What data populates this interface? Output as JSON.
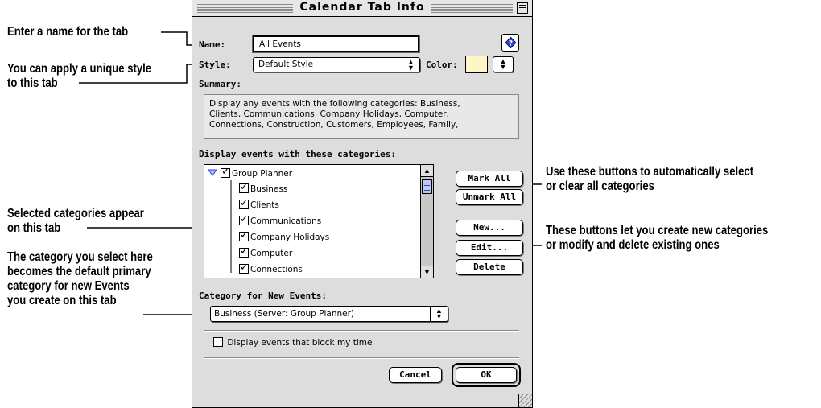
{
  "window": {
    "title": "Calendar Tab Info",
    "name_label": "Name:",
    "name_value": "All Events",
    "style_label": "Style:",
    "style_value": "Default Style",
    "color_label": "Color:",
    "color_swatch": "#fff6c8",
    "summary_label": "Summary:",
    "summary_lines": [
      "Display any events with the following categories: Business,",
      "Clients, Communications, Company Holidays, Computer,",
      "Connections, Construction, Customers, Employees, Family,"
    ],
    "categories_label": "Display events with these categories:",
    "categories": [
      {
        "label": "Group Planner",
        "checked": true,
        "level": 0
      },
      {
        "label": "Business",
        "checked": true,
        "level": 1
      },
      {
        "label": "Clients",
        "checked": true,
        "level": 1
      },
      {
        "label": "Communications",
        "checked": true,
        "level": 1
      },
      {
        "label": "Company Holidays",
        "checked": true,
        "level": 1
      },
      {
        "label": "Computer",
        "checked": true,
        "level": 1
      },
      {
        "label": "Connections",
        "checked": true,
        "level": 1
      }
    ],
    "buttons": {
      "mark_all": "Mark All",
      "unmark_all": "Unmark All",
      "new": "New...",
      "edit": "Edit...",
      "delete": "Delete",
      "cancel": "Cancel",
      "ok": "OK"
    },
    "new_events_label": "Category for New Events:",
    "new_events_value": "Business (Server: Group Planner)",
    "block_time_label": "Display events that block my time",
    "block_time_checked": false
  },
  "callouts": {
    "name": "Enter a name for the tab",
    "style_line1": "You can apply a unique style",
    "style_line2": "to this tab",
    "selected_line1": "Selected categories appear",
    "selected_line2": "on this tab",
    "primary_line1": "The category you select here",
    "primary_line2": "becomes the default primary",
    "primary_line3": "category for new Events",
    "primary_line4": "you create on this tab",
    "markall_line1": "Use these buttons to automatically select",
    "markall_line2": "or clear all categories",
    "newedit_line1": "These buttons let you create new categories",
    "newedit_line2": "or modify and delete existing ones"
  },
  "icons": {
    "help": "help-balloon-icon",
    "disclosure": "disclosure-triangle-open-icon",
    "popup_arrows": "up-down-arrows-icon",
    "zoom": "zoom-box-icon",
    "grow": "size-box-icon"
  }
}
